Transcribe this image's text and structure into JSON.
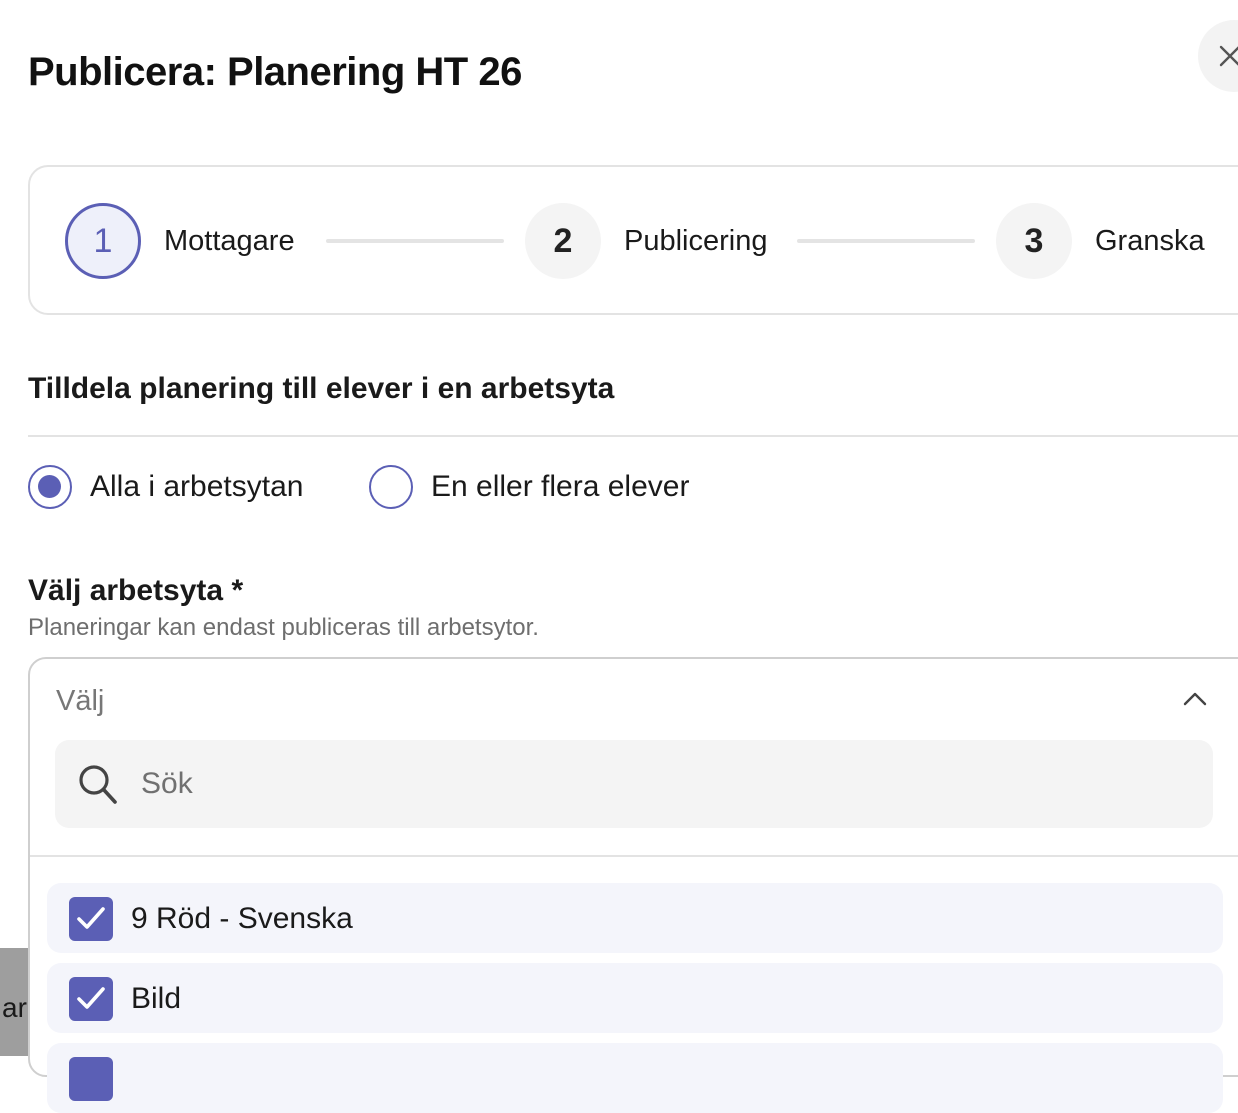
{
  "background": {
    "partial_text": "ar"
  },
  "modal": {
    "title": "Publicera: Planering HT 26"
  },
  "stepper": {
    "steps": [
      {
        "number": "1",
        "label": "Mottagare"
      },
      {
        "number": "2",
        "label": "Publicering"
      },
      {
        "number": "3",
        "label": "Granska"
      }
    ]
  },
  "assign": {
    "heading": "Tilldela planering till elever i en arbetsyta",
    "options": [
      {
        "label": "Alla i arbetsytan"
      },
      {
        "label": "En eller flera elever"
      }
    ]
  },
  "workspace": {
    "label": "Välj arbetsyta *",
    "hint": "Planeringar kan endast publiceras till arbetsytor.",
    "dropdown_value": "Välj",
    "search_placeholder": "Sök",
    "items": [
      {
        "label": "9 Röd - Svenska"
      },
      {
        "label": "Bild"
      },
      {
        "label": ""
      }
    ]
  },
  "colors": {
    "accent": "#5b5fb5",
    "accent_light": "#eef0fa",
    "option_bg": "#f4f5fb",
    "border": "#e3e3e3"
  }
}
